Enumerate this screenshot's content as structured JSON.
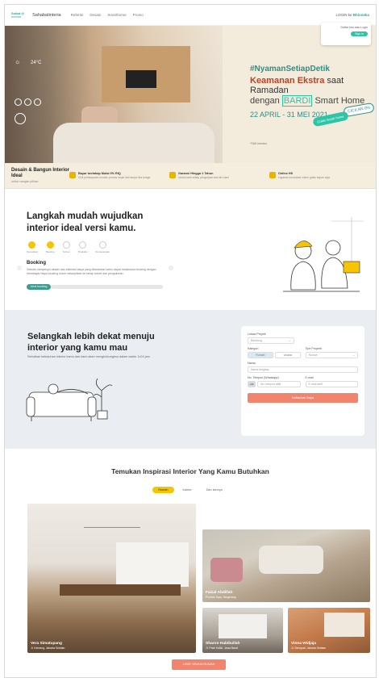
{
  "nav": {
    "logo_top": "Sobat @",
    "logo_bottom": "Interior",
    "brand": "Sahabatinteria",
    "links": [
      "Refertie",
      "Desain",
      "Smarthome",
      "Promo"
    ],
    "right_label": "LOGIN ke",
    "right_brand": "Bhinneka",
    "dropdown_text": "Daftar kan atau Login",
    "dropdown_button": "Sign In"
  },
  "hero": {
    "weather_temp": "24°C",
    "tag": "#NyamanSetiapDetik",
    "title_red": "Keamanan Ekstra",
    "title_rest": " saat Ramadan",
    "sub_pre": "dengan ",
    "sub_brand": "BARDI",
    "sub_post": " Smart Home",
    "date": "22 APRIL - 31 MEI 2021",
    "badge_green": "Gratis Smart home",
    "badge_cicilan": "CICILAN 0%",
    "small_note": "*S&K berlaku"
  },
  "features": {
    "main_title": "Desain & Bangun Interior Ideal",
    "main_sub": "untuk ruangan pilihan",
    "items": [
      {
        "title": "Bayar bertahap Mulai 0% RIQ",
        "desc": "Cicil pembayaran mudah, proses cepat dan tanpa riba bunga"
      },
      {
        "title": "Garansi Hingga 1 Tahun",
        "desc": "Untuk hasil setiap pengerjaan dari tim kami"
      },
      {
        "title": "Online HS",
        "desc": "Layanan konsultasi online gratis kapan saja"
      }
    ]
  },
  "steps": {
    "title": "Langkah mudah wujudkan interior ideal versi kamu.",
    "dots": [
      "Konsultasi",
      "Booking",
      "Survei",
      "Produksi",
      "Pemasangan"
    ],
    "booking_title": "Booking",
    "booking_desc": "Setelah menyetujui desain dan estimasi biaya yang ditawarkan kamu dapat melakukan booking dengan membayar biaya booking untuk melanjutkan ke tahap survei dan pengukuran.",
    "booking_button": "Lihat booking"
  },
  "contact": {
    "title": "Selangkah lebih dekat menuju interior yang kamu mau",
    "desc": "Sebutkan kebutuhan interior kamu dan kami akan menghubungimu dalam waktu 1x24 jam",
    "form": {
      "city_label": "Lokasi Proyek",
      "city_value": "Bandung",
      "category_label": "Kategori",
      "category_options": [
        "Rumah",
        "Usaha"
      ],
      "type_label": "Tipe Properti",
      "type_value": "Rumah",
      "name_label": "Nama",
      "name_placeholder": "Nama lengkap",
      "phone_label": "No. Telepon (Whatsapp)",
      "phone_prefix": "+62",
      "phone_placeholder": "No. telepon aktif",
      "email_label": "E-mail",
      "email_placeholder": "E-mail aktif",
      "submit": "Daftarkan Saya"
    }
  },
  "inspiration": {
    "title": "Temukan Inspirasi Interior Yang Kamu Butuhkan",
    "tabs": [
      "Rumah",
      "Kantor",
      "Dan lainnya"
    ],
    "cards": [
      {
        "name": "Vera Simatupang",
        "place": "Jl. Kemang, Jakarta Selatan"
      },
      {
        "name": "Faizal Abdillah",
        "place": "Pondok Jaya, Tangerang"
      },
      {
        "name": "Sharon Habibullah",
        "place": "Jl. Pasir Kaliki, Jawa Barat"
      },
      {
        "name": "Vinna Widjaja",
        "place": "Jl. Senopati, Jakarta Selatan"
      }
    ],
    "all_button": "LIHAT SEMUA RUMAH"
  }
}
